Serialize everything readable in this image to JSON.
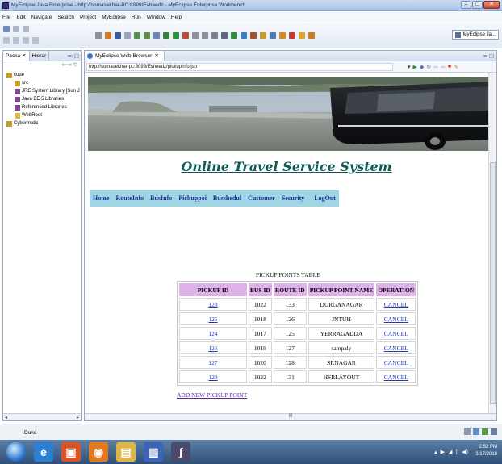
{
  "window": {
    "title": "MyEclipse Java Enterprise - http://somasekhar-PC:8099/Evheedz - MyEclipse Enterprise Workbench",
    "min": "–",
    "max": "□",
    "close": "✕"
  },
  "menu": [
    "File",
    "Edit",
    "Navigate",
    "Search",
    "Project",
    "MyEclipse",
    "Run",
    "Window",
    "Help"
  ],
  "perspective": "MyEclipse Ja...",
  "left_panel": {
    "tabs": [
      "Packa",
      "Hierar"
    ],
    "tab_close": "✕",
    "controls": "▭ ▢",
    "toolbar": "⇦ ⇨ ▽",
    "tree": [
      {
        "label": "code",
        "level": 1,
        "color": "#c79a2c"
      },
      {
        "label": "src",
        "level": 2,
        "color": "#c79a2c"
      },
      {
        "label": "JRE System Library [Sun J",
        "level": 2,
        "color": "#7b4a8f"
      },
      {
        "label": "Java EE 5 Libraries",
        "level": 2,
        "color": "#7b4a8f"
      },
      {
        "label": "Referenced Libraries",
        "level": 2,
        "color": "#7b4a8f"
      },
      {
        "label": "WebRoot",
        "level": 2,
        "color": "#e0b64a"
      },
      {
        "label": "Cybermatic",
        "level": 1,
        "color": "#c79a2c"
      }
    ],
    "hscroll": [
      "◂",
      "▸"
    ]
  },
  "browser": {
    "tab_label": "MyEclipse Web Browser",
    "tab_close": "✕",
    "minmax": "▭ ▢",
    "url": "http://somasekhar-pc:8099/Evheedz/pickupinfo.jsp",
    "nav_icons": [
      "▾",
      "▶",
      "◆",
      "↻",
      "⇦",
      "⇨",
      "■",
      "✎"
    ]
  },
  "page": {
    "site_title": "Online Travel Service System",
    "nav": [
      "Home",
      "RouteInfo",
      "BusInfo",
      "Pickuppoi",
      "Busshedul",
      "Customer",
      "Security",
      "LogOut"
    ],
    "table_caption": "PICKUP POINTS TABLE",
    "columns": [
      "PICKUP ID",
      "BUS ID",
      "ROUTE ID",
      "PICKUP POINT NAME",
      "OPERATION"
    ],
    "rows": [
      {
        "pickup_id": "128",
        "bus_id": "1022",
        "route_id": "133",
        "name": "DURGANAGAR",
        "op": "CANCEL"
      },
      {
        "pickup_id": "125",
        "bus_id": "1018",
        "route_id": "126",
        "name": "JNTUH",
        "op": "CANCEL"
      },
      {
        "pickup_id": "124",
        "bus_id": "1017",
        "route_id": "125",
        "name": "YERRAGADDA",
        "op": "CANCEL"
      },
      {
        "pickup_id": "126",
        "bus_id": "1019",
        "route_id": "127",
        "name": "sampaly",
        "op": "CANCEL"
      },
      {
        "pickup_id": "127",
        "bus_id": "1020",
        "route_id": "128",
        "name": "SRNAGAR",
        "op": "CANCEL"
      },
      {
        "pickup_id": "129",
        "bus_id": "1022",
        "route_id": "131",
        "name": "HSRLAYOUT",
        "op": "CANCEL"
      }
    ],
    "add_link": "ADD NEW PICKUP POINT"
  },
  "hscroll_mark": "III",
  "status": {
    "text": "Done"
  },
  "taskbar": {
    "time": "2:52 PM",
    "date": "3/17/2018",
    "apps": [
      {
        "glyph": "e",
        "color": "#2c7fd1"
      },
      {
        "glyph": "▣",
        "color": "#d8552a"
      },
      {
        "glyph": "◉",
        "color": "#e07a1c"
      },
      {
        "glyph": "▤",
        "color": "#e0b548"
      },
      {
        "glyph": "▥",
        "color": "#3b64b8"
      },
      {
        "glyph": "∫",
        "color": "#4a4a6a"
      }
    ],
    "tray_icons": [
      "▴",
      "▶",
      "◢",
      "▯",
      "◀)"
    ]
  },
  "colors": {
    "title_link": "#0f5b54",
    "nav_bg": "#9fd6e6",
    "header_bg": "#e0b2ea",
    "link": "#2238b0"
  }
}
